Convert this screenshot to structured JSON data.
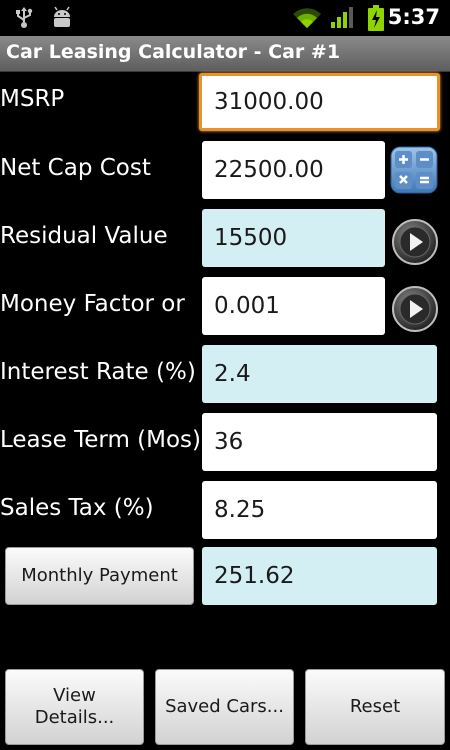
{
  "status_bar": {
    "time": "5:37",
    "icons": [
      "usb-icon",
      "android-debug-icon",
      "wifi-icon",
      "signal-icon",
      "battery-charging-icon"
    ]
  },
  "title_bar": {
    "title": "Car Leasing Calculator - Car #1"
  },
  "form": {
    "msrp": {
      "label": "MSRP",
      "value": "31000.00"
    },
    "net_cap_cost": {
      "label": "Net Cap Cost",
      "value": "22500.00"
    },
    "residual_value": {
      "label": "Residual Value",
      "value": "15500"
    },
    "money_factor": {
      "label": "Money Factor or",
      "value": "0.001"
    },
    "interest_rate": {
      "label": "Interest Rate (%)",
      "value": "2.4"
    },
    "lease_term": {
      "label": "Lease Term (Mos)",
      "value": "36"
    },
    "sales_tax": {
      "label": "Sales Tax (%)",
      "value": "8.25"
    },
    "monthly_payment": {
      "button_label": "Monthly Payment",
      "value": "251.62"
    }
  },
  "bottom_buttons": {
    "view_details_line1": "View",
    "view_details_line2": "Details...",
    "saved_cars": "Saved Cars...",
    "reset": "Reset"
  },
  "colors": {
    "accent_focus": "#e8922c",
    "computed_field": "#d4eff4",
    "input_field": "#ffffff",
    "title_bar": "#6e6e6e",
    "battery": "#8fd400",
    "wifi": "#8fd400"
  }
}
